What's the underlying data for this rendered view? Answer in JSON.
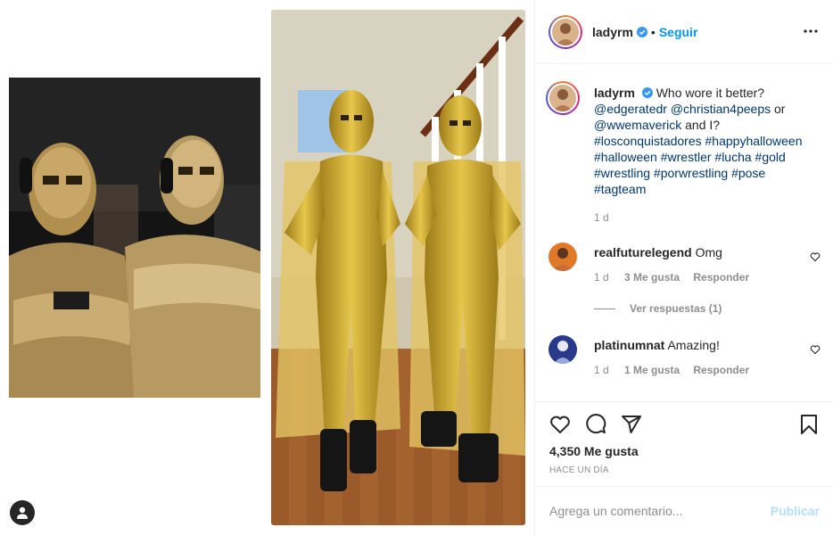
{
  "post": {
    "username": "ladyrm",
    "follow_label": "Seguir",
    "dot": "•"
  },
  "caption": {
    "username": "ladyrm",
    "text_1": "Who wore it better?",
    "mention_1": "@edgeratedr",
    "mention_2": "@christian4peeps",
    "text_or": "or",
    "mention_3": "@wwemaverick",
    "text_and": "and I?",
    "hashtags_line1": "#losconquistadores #happyhalloween",
    "hashtags_line2": "#halloween #wrestler #lucha #gold",
    "hashtags_line3": "#wrestling #porwrestling #pose",
    "hashtags_line4": "#tagteam",
    "age": "1 d"
  },
  "comments": [
    {
      "username": "realfuturelegend",
      "text": "Omg",
      "age": "1 d",
      "likes": "3 Me gusta",
      "reply": "Responder",
      "view_replies": "Ver respuestas (1)"
    },
    {
      "username": "platinumnat",
      "text": "Amazing!",
      "age": "1 d",
      "likes": "1 Me gusta",
      "reply": "Responder"
    }
  ],
  "stats": {
    "likes": "4,350 Me gusta",
    "time": "HACE UN DÍA"
  },
  "add_comment": {
    "placeholder": "Agrega un comentario...",
    "publish": "Publicar"
  },
  "colors": {
    "accent": "#0095f6",
    "publish_disabled": "#b2dffc",
    "gold": "#c9a227"
  }
}
